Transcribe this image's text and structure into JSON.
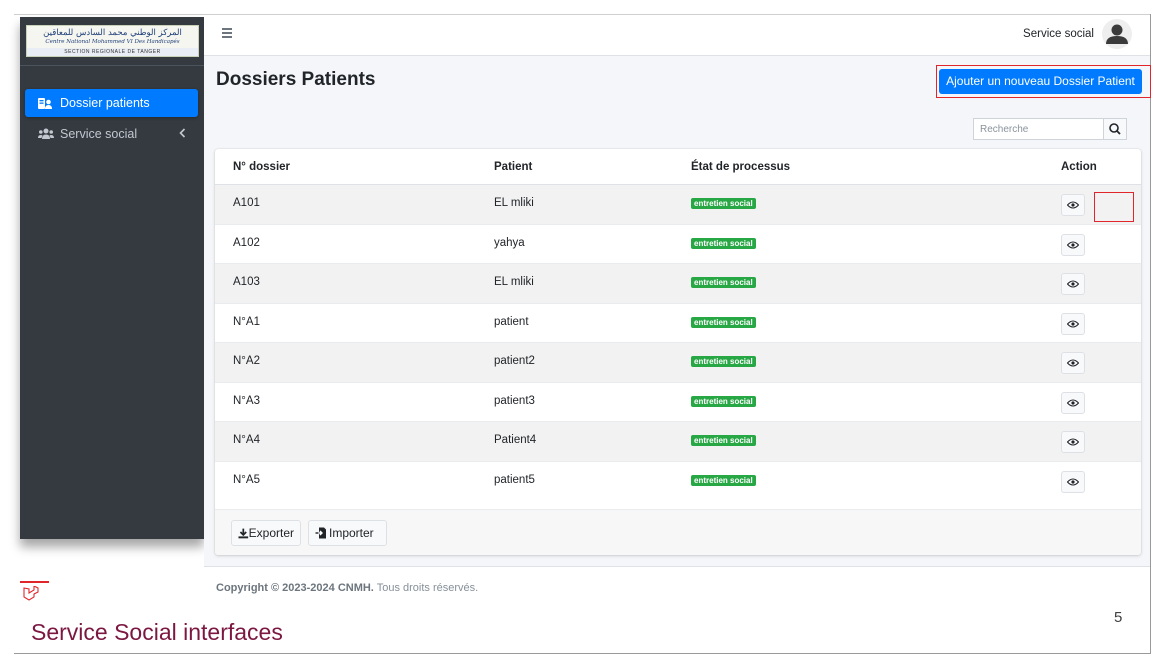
{
  "brand": {
    "arabic": "المركز الوطني محمد السادس للمعاقين",
    "french": "Centre National Mohammed VI Des Handicapés",
    "section": "SECTION REGIONALE DE TANGER"
  },
  "sidebar": {
    "items": [
      {
        "label": "Dossier patients",
        "icon": "folder-user-icon",
        "active": true
      },
      {
        "label": "Service social",
        "icon": "users-icon",
        "active": false
      }
    ]
  },
  "header": {
    "user_name": "Service social"
  },
  "page": {
    "title": "Dossiers Patients",
    "add_button": "Ajouter un nouveau Dossier Patient",
    "search_placeholder": "Recherche"
  },
  "table": {
    "columns": [
      "N° dossier",
      "Patient",
      "État de processus",
      "Action"
    ],
    "rows": [
      {
        "num": "A101",
        "patient": "EL mliki",
        "status": "entretien social"
      },
      {
        "num": "A102",
        "patient": "yahya",
        "status": "entretien social"
      },
      {
        "num": "A103",
        "patient": "EL mliki",
        "status": "entretien social"
      },
      {
        "num": "N°A1",
        "patient": "patient",
        "status": "entretien social"
      },
      {
        "num": "N°A2",
        "patient": "patient2",
        "status": "entretien social"
      },
      {
        "num": "N°A3",
        "patient": "patient3",
        "status": "entretien social"
      },
      {
        "num": "N°A4",
        "patient": "Patient4",
        "status": "entretien social"
      },
      {
        "num": "N°A5",
        "patient": "patient5",
        "status": "entretien social"
      }
    ]
  },
  "actions": {
    "export": "Exporter",
    "import": "Importer"
  },
  "footer": {
    "copyright": "Copyright © 2023-2024 CNMH.",
    "rights": "Tous droits réservés."
  },
  "slide": {
    "caption": "Service Social interfaces",
    "number": "5"
  },
  "colors": {
    "sidebar": "#343a40",
    "primary": "#007bff",
    "success": "#28a745",
    "highlight": "#e0262b",
    "caption": "#7b1740"
  }
}
